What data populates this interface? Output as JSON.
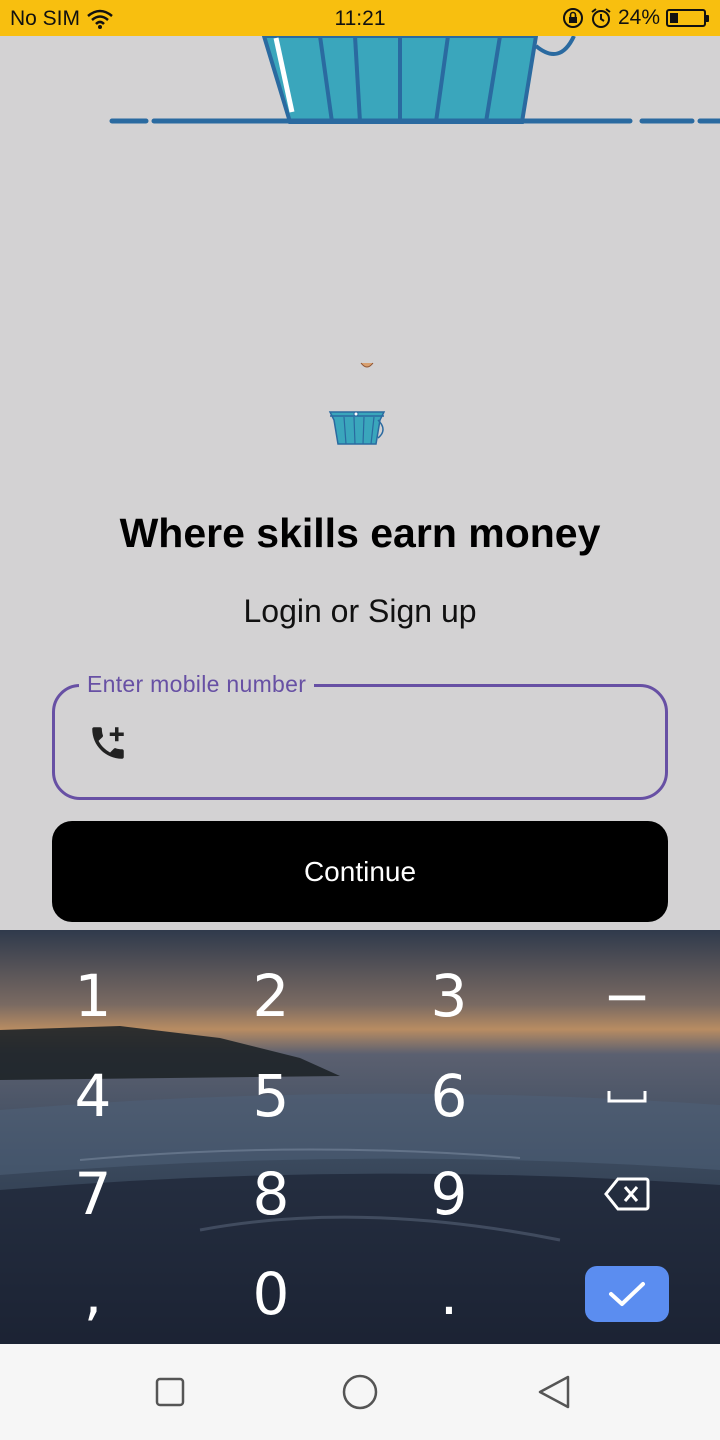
{
  "status_bar": {
    "carrier": "No SIM",
    "time": "11:21",
    "battery_percent": "24%",
    "battery_level": 0.24,
    "icons": [
      "wifi-icon",
      "rotation-lock-icon",
      "alarm-icon",
      "battery-icon"
    ]
  },
  "hero": {
    "icons": [
      "basket-illustration",
      "basket-small-icon"
    ]
  },
  "title": "Where skills earn money",
  "subtitle": "Login or Sign up",
  "phone_field": {
    "label": "Enter mobile number",
    "value": "",
    "icon": "phone-add-icon"
  },
  "continue_label": "Continue",
  "keyboard": {
    "keys": [
      "1",
      "2",
      "3",
      "−",
      "4",
      "5",
      "6",
      "space",
      "7",
      "8",
      "9",
      "backspace",
      ",",
      "0",
      ".",
      "done"
    ],
    "row1": [
      "1",
      "2",
      "3",
      "−"
    ],
    "row2": [
      "4",
      "5",
      "6"
    ],
    "row3": [
      "7",
      "8",
      "9"
    ],
    "row4": [
      ",",
      "0",
      "."
    ]
  },
  "nav": {
    "icons": [
      "recent-apps-icon",
      "home-icon",
      "back-icon"
    ]
  },
  "colors": {
    "status_bar": "#f8bf0f",
    "background": "#d3d2d3",
    "accent": "#6750a4",
    "button": "#000000",
    "keyboard_done": "#5b8df0",
    "basket": "#3aa6bc"
  }
}
